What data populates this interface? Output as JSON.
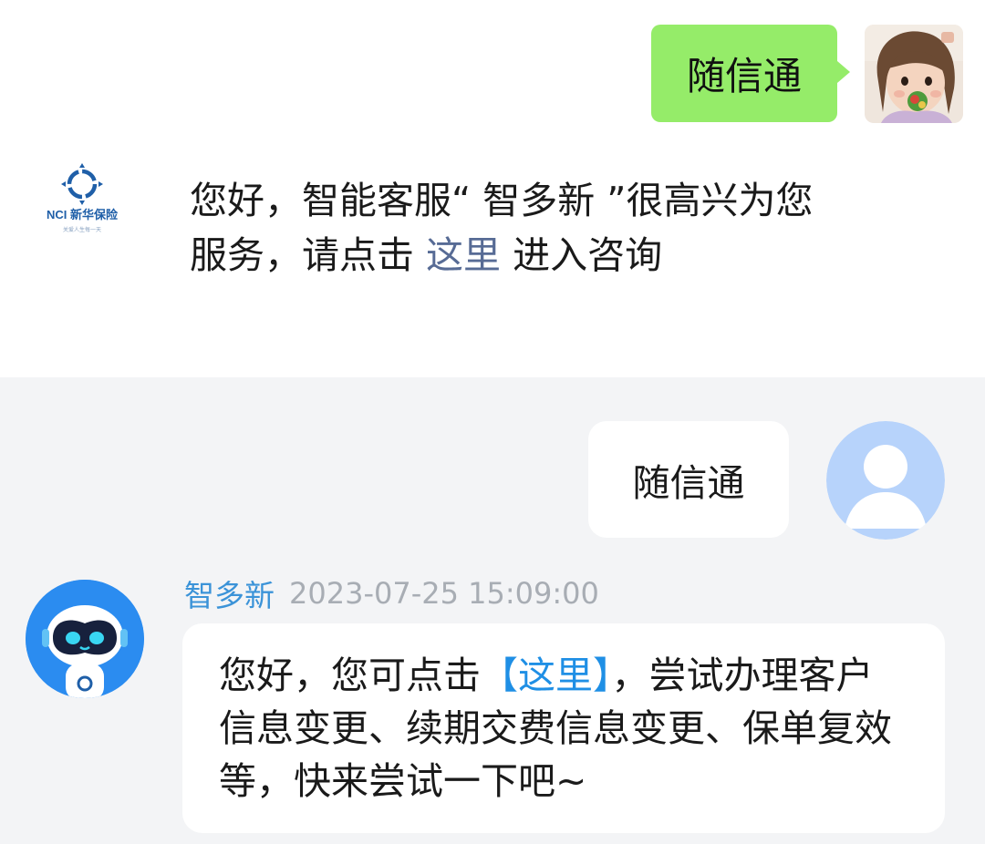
{
  "wechat": {
    "outgoing_text": "随信通",
    "bot_logo": {
      "brand": "NCI 新华保险",
      "tagline": "关爱人生每一天"
    },
    "incoming": {
      "part1": "您好，智能客服“ 智多新 ”很高兴为您服务，请点击 ",
      "link": "这里",
      "part2": " 进入咨询"
    }
  },
  "app": {
    "outgoing_text": "随信通",
    "sender": "智多新",
    "timestamp": "2023-07-25 15:09:00",
    "incoming": {
      "part1": "您好，您可点击",
      "link": "【这里】",
      "part2": "，尝试办理客户信息变更、续期交费信息变更、保单复效等，快来尝试一下吧~"
    }
  },
  "colors": {
    "wechat_bubble_green": "#95ec69",
    "wechat_link": "#576b95",
    "app_link": "#1f8fe5",
    "app_background": "#f3f4f6"
  },
  "icons": [
    "child-photo-avatar",
    "nci-logo-icon",
    "default-user-icon",
    "robot-avatar-icon"
  ]
}
